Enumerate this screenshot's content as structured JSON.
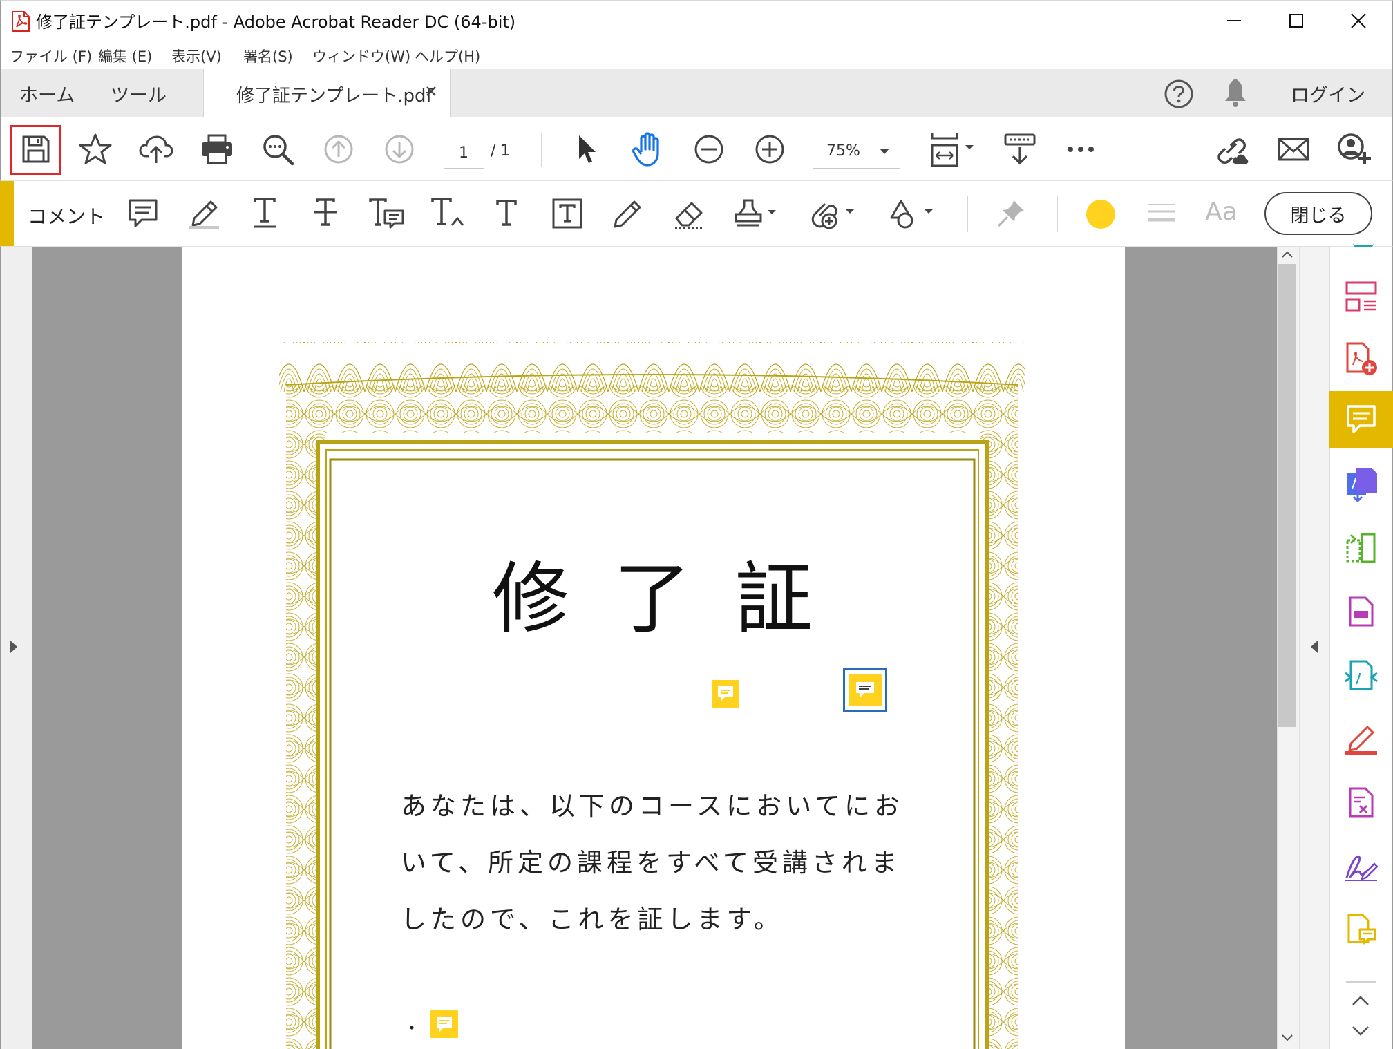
{
  "window": {
    "title": "修了証テンプレート.pdf - Adobe Acrobat Reader DC (64-bit)"
  },
  "menu": {
    "items": [
      "ファイル (F)",
      "編集 (E)",
      "表示(V)",
      "署名(S)",
      "ウィンドウ(W)",
      "ヘルプ(H)"
    ]
  },
  "tabs": {
    "home": "ホーム",
    "tools": "ツール",
    "document": "修了証テンプレート.pdf",
    "login": "ログイン"
  },
  "toolbar": {
    "page_current": "1",
    "page_total": "/ 1",
    "zoom": "75%"
  },
  "comment_bar": {
    "label": "コメント",
    "font_sample": "Aa",
    "close_label": "閉じる",
    "color_swatch": "#ffd21f"
  },
  "document": {
    "heading": "修了証",
    "body_lines": [
      "あなたは、以下のコースにおいてにお",
      "いて、所定の課程をすべて受講されま",
      "したので、これを証します。"
    ],
    "bullet": "・"
  },
  "colors": {
    "accent": "#e5b800",
    "border_gold": "#b9a316",
    "save_highlight": "#e4262b",
    "note_yellow": "#ffd21f",
    "hand_tool_blue": "#1473e6"
  },
  "right_rail_icons": [
    "organize-pages-icon",
    "create-pdf-icon",
    "comment-icon",
    "export-pdf-icon",
    "compare-icon",
    "edit-pdf-icon",
    "convert-icon",
    "fill-sign-icon",
    "redact-icon",
    "sign-icon",
    "send-comments-icon"
  ]
}
